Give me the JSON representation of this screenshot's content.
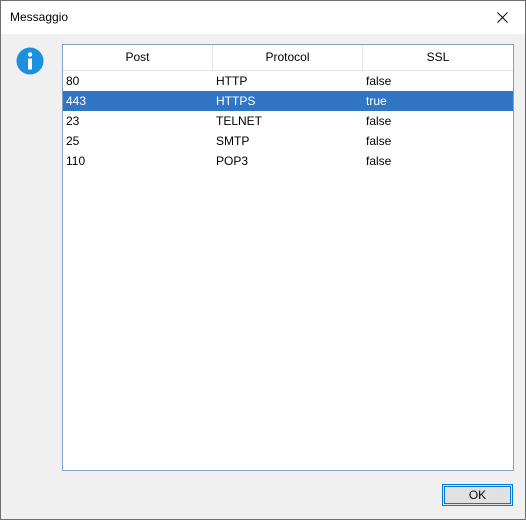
{
  "dialog": {
    "title": "Messaggio",
    "icon": "information-icon",
    "accent_color": "#1b8fe0",
    "ok_label": "OK"
  },
  "table": {
    "columns": [
      "Post",
      "Protocol",
      "SSL"
    ],
    "selected_row": 1,
    "selection_color": "#3176c4",
    "rows": [
      [
        "80",
        "HTTP",
        "false"
      ],
      [
        "443",
        "HTTPS",
        "true"
      ],
      [
        "23",
        "TELNET",
        "false"
      ],
      [
        "25",
        "SMTP",
        "false"
      ],
      [
        "110",
        "POP3",
        "false"
      ]
    ]
  }
}
